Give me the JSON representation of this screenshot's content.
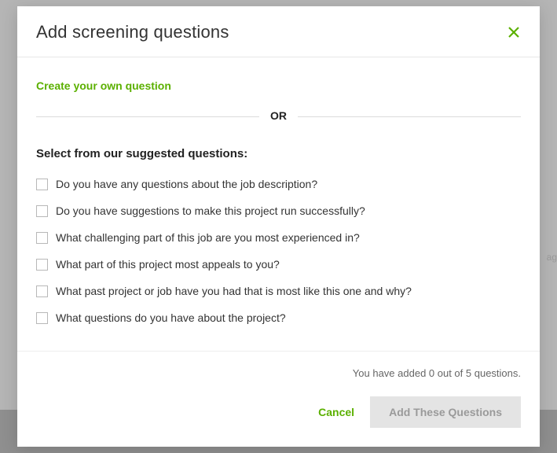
{
  "modal": {
    "title": "Add screening questions",
    "create_link": "Create your own question",
    "divider": "OR",
    "suggest_heading": "Select from our suggested questions:",
    "questions": [
      "Do you have any questions about the job description?",
      "Do you have suggestions to make this project run successfully?",
      "What challenging part of this job are you most experienced in?",
      "What part of this project most appeals to you?",
      "What past project or job have you had that is most like this one and why?",
      "What questions do you have about the project?"
    ],
    "count_text": "You have added 0 out of 5 questions.",
    "cancel": "Cancel",
    "add": "Add These Questions"
  },
  "bg_fragment": "ag"
}
